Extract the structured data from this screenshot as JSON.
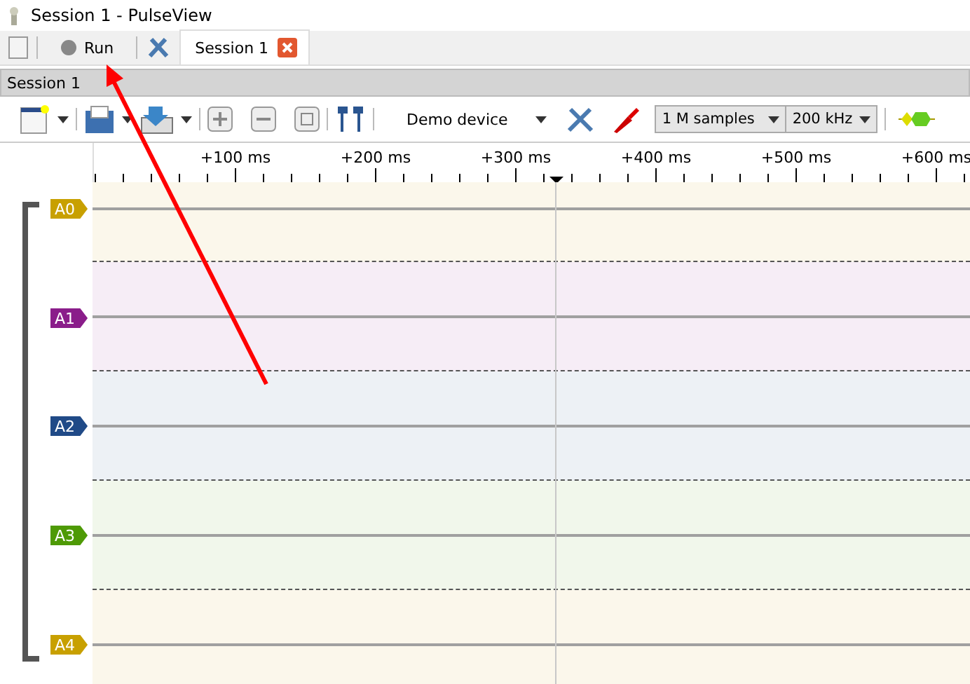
{
  "window": {
    "title": "Session 1 - PulseView"
  },
  "main_toolbar": {
    "run_label": "Run"
  },
  "tabs": [
    {
      "label": "Session 1",
      "selected": true
    }
  ],
  "session_header": "Session 1",
  "toolbar": {
    "device": "Demo device",
    "samples": "1 M samples",
    "rate": "200 kHz"
  },
  "ruler": {
    "labels": [
      "+100 ms",
      "+200 ms",
      "+300 ms",
      "+400 ms",
      "+500 ms",
      "+600 ms"
    ]
  },
  "channels": [
    {
      "name": "A0",
      "color": "#c8a000"
    },
    {
      "name": "A1",
      "color": "#8a1d8a"
    },
    {
      "name": "A2",
      "color": "#204a87"
    },
    {
      "name": "A3",
      "color": "#4e9a06"
    },
    {
      "name": "A4",
      "color": "#c8a000"
    }
  ]
}
